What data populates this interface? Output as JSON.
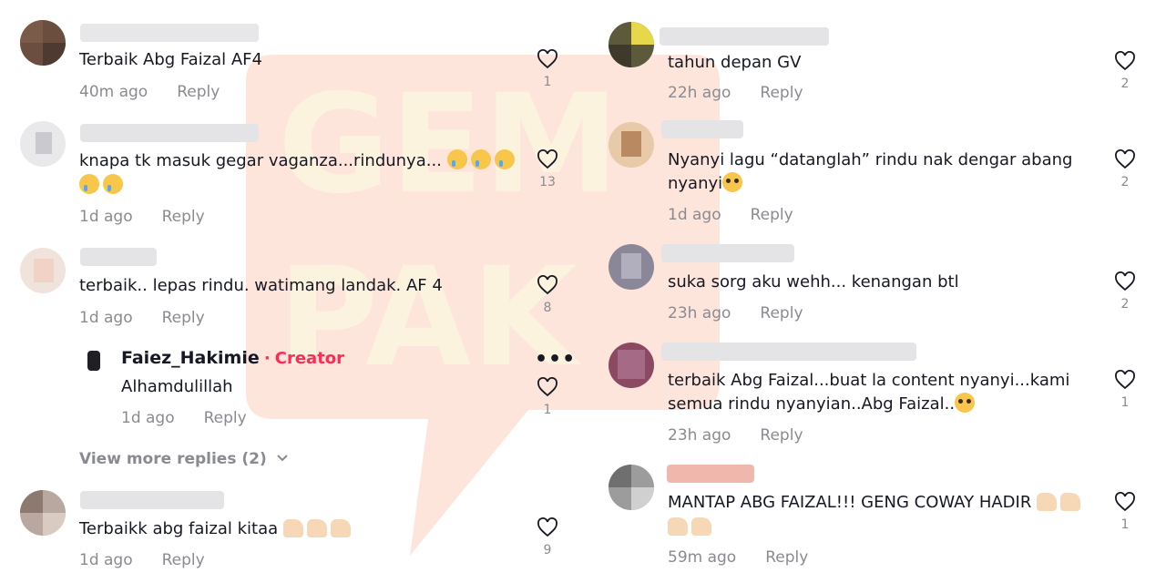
{
  "watermark": {
    "brand": "GEMPAK",
    "color": "#fde7d8"
  },
  "left_comments": [
    {
      "text": "Terbaik Abg Faizal AF4",
      "time": "40m ago",
      "reply": "Reply",
      "likes": "1"
    },
    {
      "text": "knapa tk masuk gegar vaganza...rindunya...",
      "text2": "",
      "time": "1d ago",
      "reply": "Reply",
      "likes": "13"
    },
    {
      "text": "terbaik.. lepas rindu. watimang landak. AF 4",
      "time": "1d ago",
      "reply": "Reply",
      "likes": "8"
    },
    {
      "text": "Terbaikk abg faizal kitaa",
      "time": "1d ago",
      "reply": "Reply",
      "likes": "9"
    }
  ],
  "creator_reply": {
    "name": "Faiez_Hakimie",
    "separator": "·",
    "tag": "Creator",
    "text": "Alhamdulillah",
    "time": "1d ago",
    "reply": "Reply",
    "likes": "1",
    "more": "•••"
  },
  "view_more": "View more replies (2)",
  "right_comments": [
    {
      "text": "tahun depan GV",
      "time": "22h ago",
      "reply": "Reply",
      "likes": "2"
    },
    {
      "text": "Nyanyi lagu “datanglah” rindu nak dengar abang",
      "text2": "nyanyi",
      "time": "1d ago",
      "reply": "Reply",
      "likes": "2"
    },
    {
      "text": "suka sorg aku wehh... kenangan btl",
      "time": "23h ago",
      "reply": "Reply",
      "likes": "2"
    },
    {
      "text": "terbaik Abg Faizal...buat la content nyanyi...kami",
      "text2": "semua rindu nyanyian..Abg Faizal..",
      "time": "23h ago",
      "reply": "Reply",
      "likes": "1"
    },
    {
      "text": "MANTAP ABG FAIZAL!!! GENG COWAY HADIR",
      "time": "59m ago",
      "reply": "Reply",
      "likes": "1"
    }
  ]
}
